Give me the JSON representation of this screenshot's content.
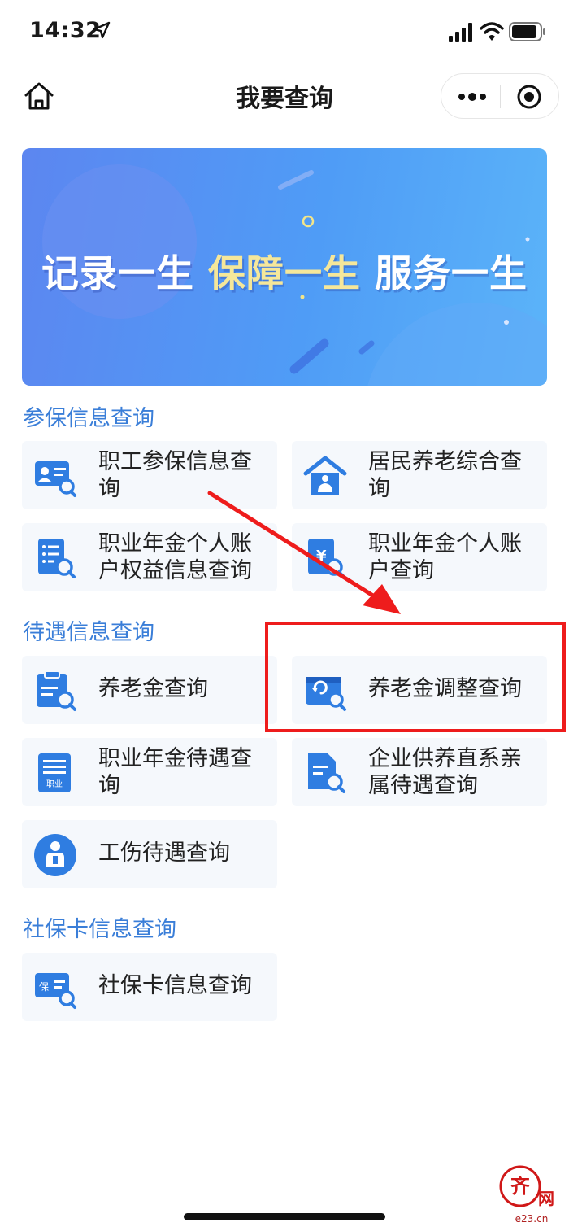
{
  "status_bar": {
    "time": "14:32"
  },
  "nav": {
    "title": "我要查询"
  },
  "banner": {
    "slogan_part1": "记录一生 ",
    "slogan_part2": "保障一生",
    "slogan_part3": " 服务一生"
  },
  "sections": {
    "insured": {
      "title": "参保信息查询",
      "items": [
        {
          "label": "职工参保信息查询",
          "icon": "id-card-search-icon"
        },
        {
          "label": "居民养老综合查询",
          "icon": "house-person-icon"
        },
        {
          "label": "职业年金个人账户权益信息查询",
          "icon": "document-list-search-icon"
        },
        {
          "label": "职业年金个人账户查询",
          "icon": "yuan-document-search-icon"
        }
      ]
    },
    "benefits": {
      "title": "待遇信息查询",
      "items": [
        {
          "label": "养老金查询",
          "icon": "clipboard-search-icon"
        },
        {
          "label": "养老金调整查询",
          "icon": "wallet-refresh-search-icon"
        },
        {
          "label": "职业年金待遇查询",
          "icon": "document-badge-icon",
          "icon_text": "职业"
        },
        {
          "label": "企业供养直系亲属待遇查询",
          "icon": "file-search-icon"
        },
        {
          "label": "工伤待遇查询",
          "icon": "injured-person-icon"
        }
      ]
    },
    "card": {
      "title": "社保卡信息查询",
      "items": [
        {
          "label": "社保卡信息查询",
          "icon": "insurance-card-search-icon",
          "icon_text": "保"
        }
      ]
    }
  },
  "watermark": {
    "text": "e23.cn"
  },
  "colors": {
    "accent": "#3a7ed8",
    "icon": "#2f7de1",
    "annotation": "#ee1c1c",
    "card_bg": "#f5f8fc"
  }
}
